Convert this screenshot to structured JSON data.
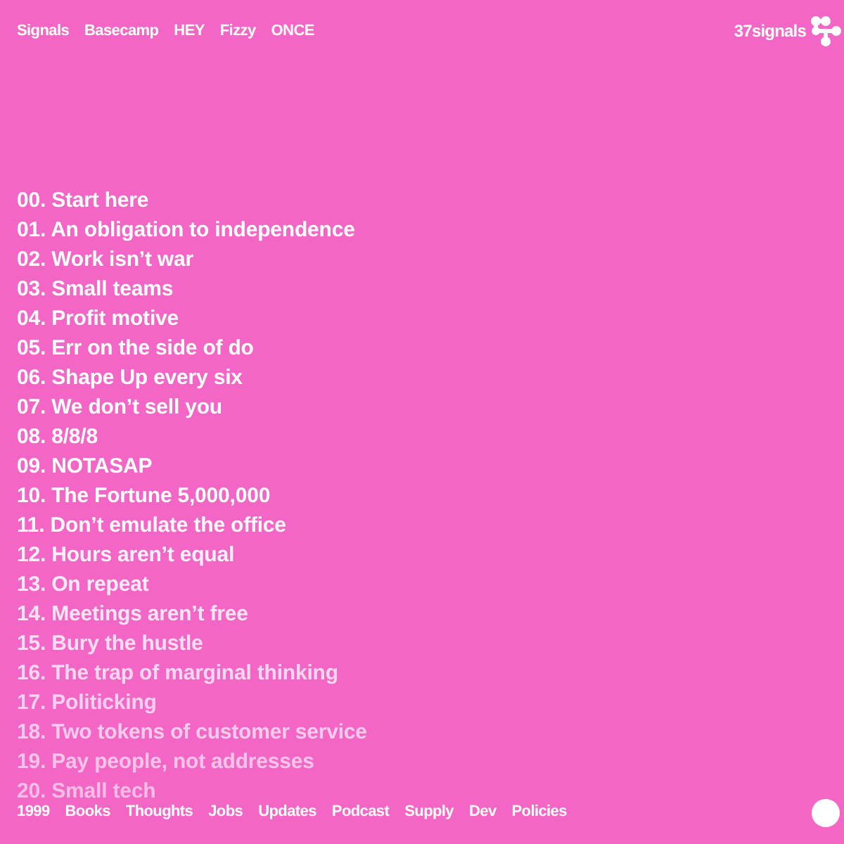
{
  "top_nav": {
    "links": [
      "Signals",
      "Basecamp",
      "HEY",
      "Fizzy",
      "ONCE"
    ]
  },
  "brand": {
    "name": "37signals"
  },
  "principles": [
    {
      "text": "00. Start here"
    },
    {
      "text": "01. An obligation to independence"
    },
    {
      "text": "02. Work isn’t war"
    },
    {
      "text": "03. Small teams"
    },
    {
      "text": "04. Profit motive"
    },
    {
      "text": "05. Err on the side of do"
    },
    {
      "text": "06. Shape Up every six"
    },
    {
      "text": "07. We don’t sell you"
    },
    {
      "text": "08. 8/8/8"
    },
    {
      "text": "09. NOTASAP"
    },
    {
      "text": "10. The Fortune 5,000,000"
    },
    {
      "text": "11. Don’t emulate the office"
    },
    {
      "text": "12. Hours aren’t equal"
    },
    {
      "text": "13. On repeat"
    },
    {
      "text": "14. Meetings aren’t free"
    },
    {
      "text": "15. Bury the hustle"
    },
    {
      "text": "16. The trap of marginal thinking"
    },
    {
      "text": "17. Politicking"
    },
    {
      "text": "18. Two tokens of customer service"
    },
    {
      "text": "19. Pay people, not addresses"
    },
    {
      "text": "20. Small tech"
    }
  ],
  "footer_nav": {
    "links": [
      "1999",
      "Books",
      "Thoughts",
      "Jobs",
      "Updates",
      "Podcast",
      "Supply",
      "Dev",
      "Policies"
    ]
  }
}
